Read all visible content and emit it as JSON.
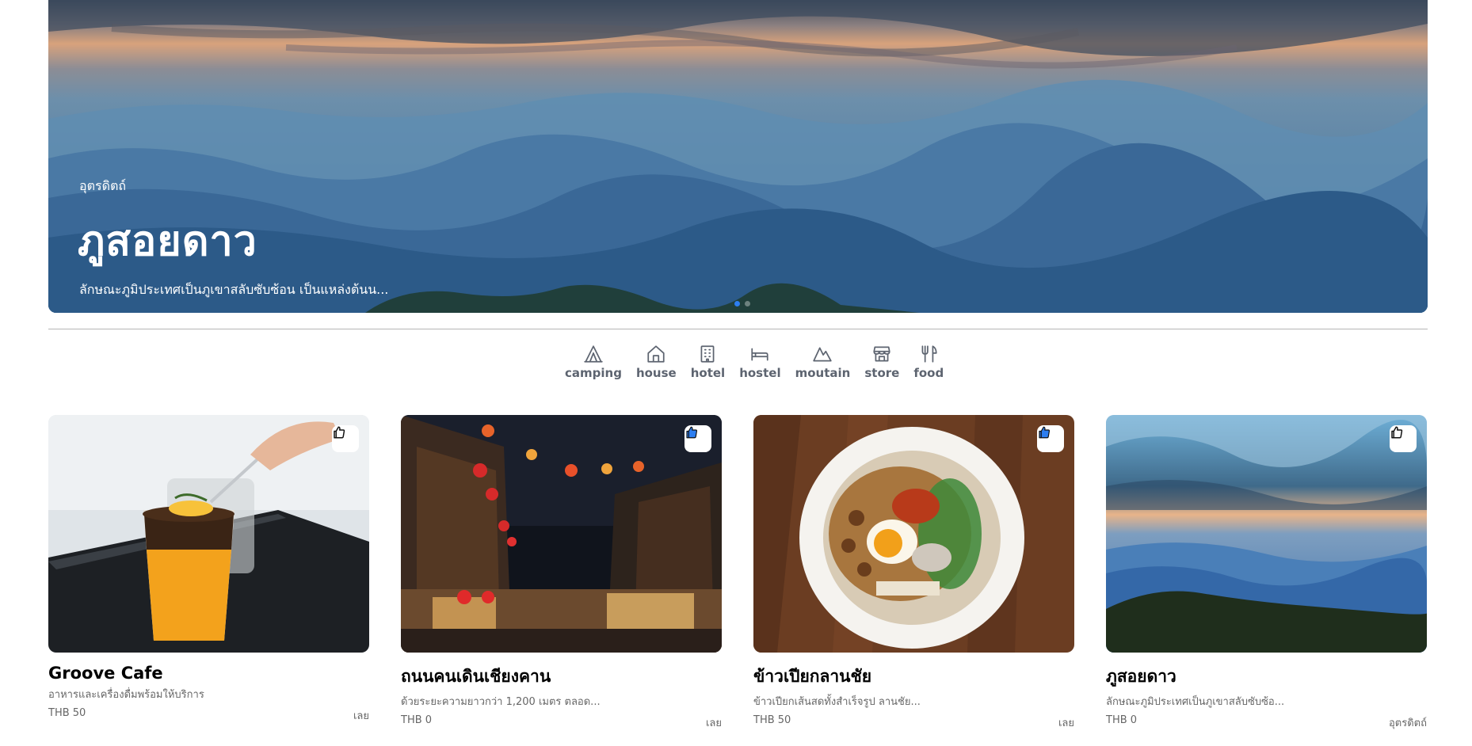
{
  "hero": {
    "province": "อุตรดิตถ์",
    "title": "ภูสอยดาว",
    "description": "ลักษณะภูมิประเทศเป็นภูเขาสลับซับซ้อน เป็นแหล่งต้นน...",
    "slides_total": 2,
    "active_slide": 1
  },
  "categories": [
    {
      "label": "camping",
      "icon": "tent-icon"
    },
    {
      "label": "house",
      "icon": "house-icon"
    },
    {
      "label": "hotel",
      "icon": "building-icon"
    },
    {
      "label": "hostel",
      "icon": "bed-icon"
    },
    {
      "label": "moutain",
      "icon": "mountain-icon"
    },
    {
      "label": "store",
      "icon": "store-icon"
    },
    {
      "label": "food",
      "icon": "utensils-icon"
    }
  ],
  "cards": [
    {
      "name": "Groove Cafe",
      "description": "อาหารและเครื่องดื่มพร้อมให้บริการ",
      "price": "THB 50",
      "location": "เลย",
      "liked": false,
      "image": "iced-coffee-drink"
    },
    {
      "name": "ถนนคนเดินเชียงคาน",
      "description": "ด้วยระยะความยาวกว่า 1,200 เมตร ตลอด...",
      "price": "THB 0",
      "location": "เลย",
      "liked": true,
      "image": "night-walking-street-lanterns"
    },
    {
      "name": "ข้าวเปียกลานชัย",
      "description": "ข้าวเปียกเส้นสดทั้งสำเร็จรูป ลานชัย...",
      "price": "THB 50",
      "location": "เลย",
      "liked": true,
      "image": "noodle-soup-bowl"
    },
    {
      "name": "ภูสอยดาว",
      "description": "ลักษณะภูมิประเทศเป็นภูเขาสลับซับซ้อ...",
      "price": "THB 0",
      "location": "อุตรดิตถ์",
      "liked": false,
      "image": "mountain-landscape"
    }
  ],
  "colors": {
    "accent": "#2d7ef0",
    "icon_gray": "#5d6470",
    "text_muted": "#666666"
  }
}
